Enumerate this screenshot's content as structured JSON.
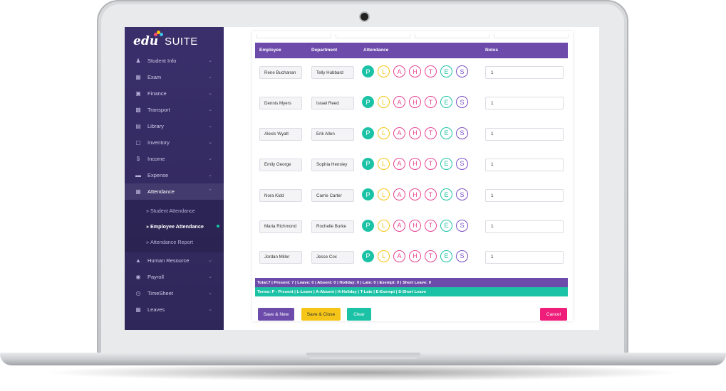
{
  "brand": {
    "part1": "edu",
    "part2": "SUITE"
  },
  "sidebar": {
    "items_top": [
      {
        "label": "Student Info",
        "icon": "user-add-icon"
      },
      {
        "label": "Exam",
        "icon": "map-icon"
      },
      {
        "label": "Finance",
        "icon": "money-icon"
      },
      {
        "label": "Transport",
        "icon": "bus-icon"
      },
      {
        "label": "Library",
        "icon": "book-icon"
      },
      {
        "label": "Inventory",
        "icon": "box-icon"
      },
      {
        "label": "Income",
        "icon": "dollar-icon"
      },
      {
        "label": "Expense",
        "icon": "card-icon"
      },
      {
        "label": "Attendance",
        "icon": "calendar-icon"
      }
    ],
    "sub_items": [
      {
        "label": "Student Attendance"
      },
      {
        "label": "Employee Attendance"
      },
      {
        "label": "Attendance Report"
      }
    ],
    "items_bottom": [
      {
        "label": "Human Resource",
        "icon": "hierarchy-icon"
      },
      {
        "label": "Payroll",
        "icon": "wallet-icon"
      },
      {
        "label": "TimeSheet",
        "icon": "clock-icon"
      },
      {
        "label": "Leaves",
        "icon": "calendar-icon"
      }
    ]
  },
  "table": {
    "headers": {
      "employee": "Employee",
      "department": "Department",
      "attendance": "Attendance",
      "notes": "Notes"
    },
    "codes": [
      {
        "letter": "P",
        "color": "#1cc2a6",
        "filled": true
      },
      {
        "letter": "L",
        "color": "#f5c518",
        "filled": false
      },
      {
        "letter": "A",
        "color": "#e84393",
        "filled": false
      },
      {
        "letter": "H",
        "color": "#e84393",
        "filled": false
      },
      {
        "letter": "T",
        "color": "#e84393",
        "filled": false
      },
      {
        "letter": "E",
        "color": "#1cc2a6",
        "filled": false
      },
      {
        "letter": "S",
        "color": "#7b4fc4",
        "filled": false
      }
    ],
    "rows": [
      {
        "employee": "Rene Buchanan",
        "department": "Telly Hubbard",
        "notes": "1"
      },
      {
        "employee": "Dennis Myers",
        "department": "Israel Reed",
        "notes": "1"
      },
      {
        "employee": "Alexis Wyatt",
        "department": "Erik Allen",
        "notes": "1"
      },
      {
        "employee": "Emily George",
        "department": "Sophia Hensley",
        "notes": "1"
      },
      {
        "employee": "Nora Kidd",
        "department": "Carrie Carter",
        "notes": "1"
      },
      {
        "employee": "Maria Richmond",
        "department": "Rochelle Burke",
        "notes": "1"
      },
      {
        "employee": "Jordan Miller",
        "department": "Jesse Cox",
        "notes": "1"
      }
    ]
  },
  "summary": {
    "total": "Total:7 | Present: 7 | Leave: 0 | Absent: 0 | Holiday: 0 | Late: 0 | Exempt: 0 | Short Leave: 0",
    "terms": "Terms: P - Present | L-Leave | A-Absent | H-Holiday | T-Late | E-Exempt | S-Short Leave"
  },
  "buttons": {
    "save_new": {
      "label": "Save & New",
      "color": "#6c4bab"
    },
    "save_close": {
      "label": "Save & Close",
      "color": "#f5c518"
    },
    "clear": {
      "label": "Clear",
      "color": "#1cc2a6"
    },
    "cancel": {
      "label": "Cancel",
      "color": "#ee1e7a"
    }
  }
}
